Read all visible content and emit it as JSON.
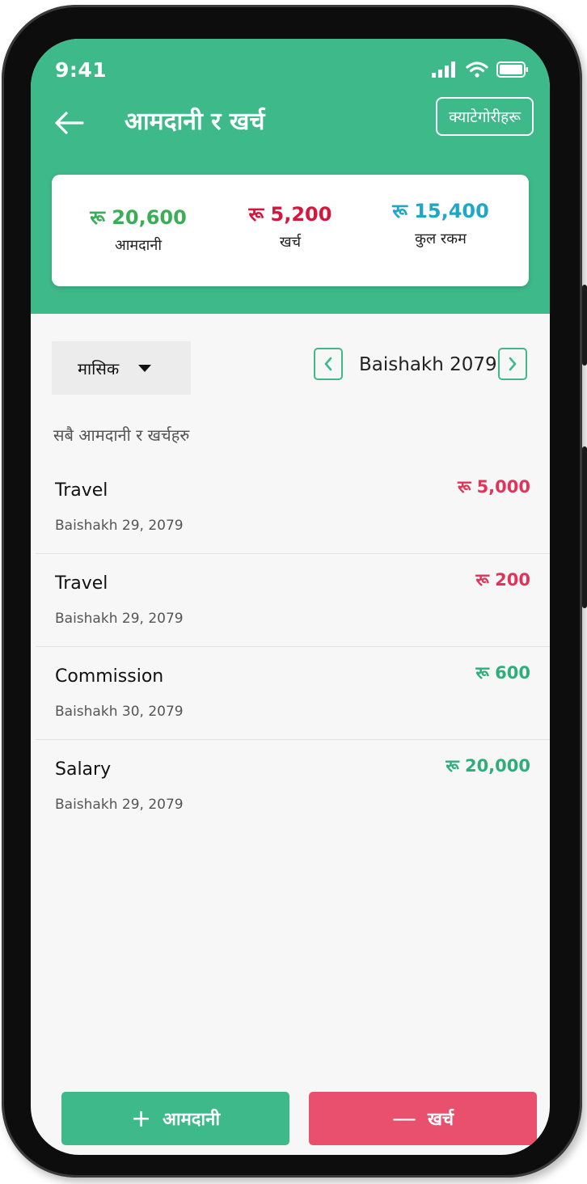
{
  "status": {
    "time": "9:41"
  },
  "header": {
    "title": "आमदानी र खर्च",
    "categories_button": "क्याटेगोरीहरू"
  },
  "summary": [
    {
      "value": "रू 20,600",
      "label": "आमदानी",
      "color": "#3aae57"
    },
    {
      "value": "रू 5,200",
      "label": "खर्च",
      "color": "#d4183d"
    },
    {
      "value": "रू 15,400",
      "label": "कुल रकम",
      "color": "#1fa7c9"
    }
  ],
  "filter": {
    "selected": "मासिक"
  },
  "period": {
    "label": "Baishakh 2079"
  },
  "section_title": "सबै आमदानी र खर्चहरु",
  "transactions": [
    {
      "name": "Travel",
      "date": "Baishakh 29, 2079",
      "amount": "रू 5,000",
      "type": "expense"
    },
    {
      "name": "Travel",
      "date": "Baishakh 29, 2079",
      "amount": "रू 200",
      "type": "expense"
    },
    {
      "name": "Commission",
      "date": "Baishakh 30, 2079",
      "amount": "रू 600",
      "type": "income"
    },
    {
      "name": "Salary",
      "date": "Baishakh 29, 2079",
      "amount": "रू 20,000",
      "type": "income"
    }
  ],
  "actions": {
    "income": {
      "symbol": "+",
      "label": "आमदानी"
    },
    "expense": {
      "symbol": "—",
      "label": "खर्च"
    }
  },
  "colors": {
    "primary": "#3db98a",
    "expense": "#e04b6a",
    "expense_button": "#e8506d",
    "income_text": "#2fae7c",
    "expense_text": "#e0345a"
  }
}
